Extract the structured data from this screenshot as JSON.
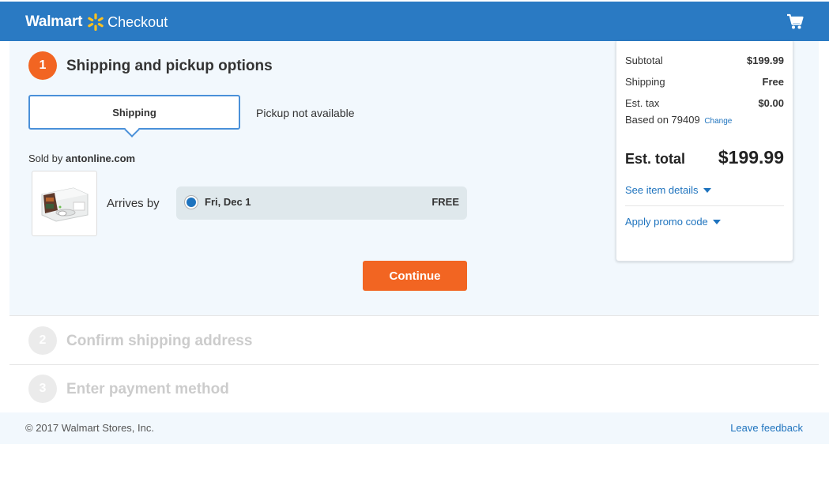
{
  "header": {
    "brand": "Walmart",
    "title": "Checkout",
    "cart_icon": "cart-icon",
    "spark_color": "#ffc220",
    "bar_color": "#2a7ac3"
  },
  "step1": {
    "number": "1",
    "title": "Shipping and pickup options",
    "tab_shipping": "Shipping",
    "pickup_text": "Pickup not available",
    "sold_by_prefix": "Sold by",
    "seller": "antonline.com",
    "product_icon": "xbox-console-thumbnail",
    "arrives_label": "Arrives by",
    "delivery_date": "Fri, Dec 1",
    "delivery_price": "FREE",
    "continue_label": "Continue"
  },
  "step2": {
    "number": "2",
    "title": "Confirm shipping address"
  },
  "step3": {
    "number": "3",
    "title": "Enter payment method"
  },
  "summary": {
    "subtotal_label": "Subtotal",
    "subtotal_value": "$199.99",
    "shipping_label": "Shipping",
    "shipping_value": "Free",
    "tax_label": "Est. tax",
    "tax_value": "$0.00",
    "zip_text": "Based on 79409",
    "change_label": "Change",
    "total_label": "Est. total",
    "total_value": "$199.99",
    "item_details_label": "See item details",
    "promo_label": "Apply promo code"
  },
  "footer": {
    "copyright": "© 2017 Walmart Stores, Inc.",
    "feedback": "Leave feedback"
  },
  "colors": {
    "accent_orange": "#f26522",
    "link_blue": "#1e73be"
  }
}
